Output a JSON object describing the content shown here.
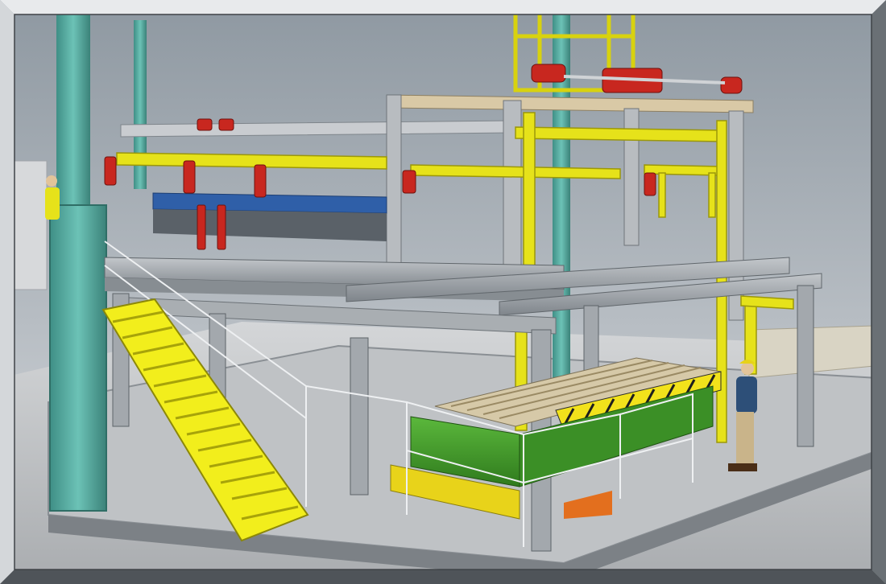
{
  "scene": {
    "subject": "industrial-plant-3d-render",
    "colors": {
      "sky_top": "#9aa3ab",
      "sky_bottom": "#d6d9dc",
      "floor": "#c9cbce",
      "steel_grey": "#9ea3a8",
      "structure_yellow": "#e6e21a",
      "column_teal": "#5fb3a8",
      "motor_red": "#c8271f",
      "tank_green": "#3f9a2a",
      "panel_beige": "#d9c9a6",
      "bevel_dark": "#5c6166",
      "bevel_light": "#e8eaec"
    },
    "icons": [
      "person-icon",
      "stair-icon",
      "motor-icon"
    ]
  }
}
